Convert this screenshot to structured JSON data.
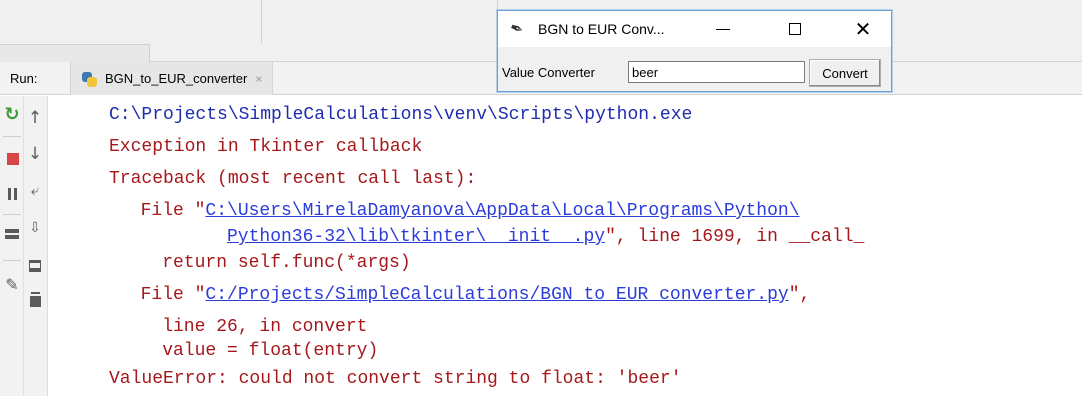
{
  "run_panel": {
    "label": "Run:",
    "tab": {
      "name": "BGN_to_EUR_converter",
      "close": "×"
    }
  },
  "toolbar_left": {
    "icons": [
      "rerun-icon",
      "stop-icon",
      "pause-icon",
      "layout-icon",
      "pin-icon"
    ]
  },
  "toolbar_right": {
    "icons": [
      "up-arrow-icon",
      "down-arrow-icon",
      "soft-wrap-icon",
      "scroll-to-end-icon",
      "print-icon",
      "trash-icon"
    ]
  },
  "console": {
    "lines": [
      "C:\\Projects\\SimpleCalculations\\venv\\Scripts\\python.exe",
      "Exception in Tkinter callback",
      "Traceback (most recent call last):",
      "  File \"",
      "C:\\Users\\MirelaDamyanova\\AppData\\Local\\Programs\\Python\\",
      "Python36-32\\lib\\tkinter\\__init__.py",
      "\", line 1699, in __call_",
      "    return self.func(*args)",
      "  File \"",
      "C:/Projects/SimpleCalculations/BGN_to_EUR_converter.py",
      "\",",
      "    line 26, in convert",
      "    value = float(entry)",
      "ValueError: could not convert string to float: 'beer'"
    ]
  },
  "tk_window": {
    "title": "BGN to EUR Conv...",
    "minimize": "—",
    "maximize": "☐",
    "close": "✕",
    "field_label": "Value Converter",
    "entry_value": "beer",
    "button_label": "Convert"
  },
  "colors": {
    "console_blue": "#1d2bb1",
    "console_red": "#a5181b",
    "link_blue": "#2a3cdb",
    "stop_red": "#d84545",
    "rerun_green": "#3a9a3a"
  }
}
